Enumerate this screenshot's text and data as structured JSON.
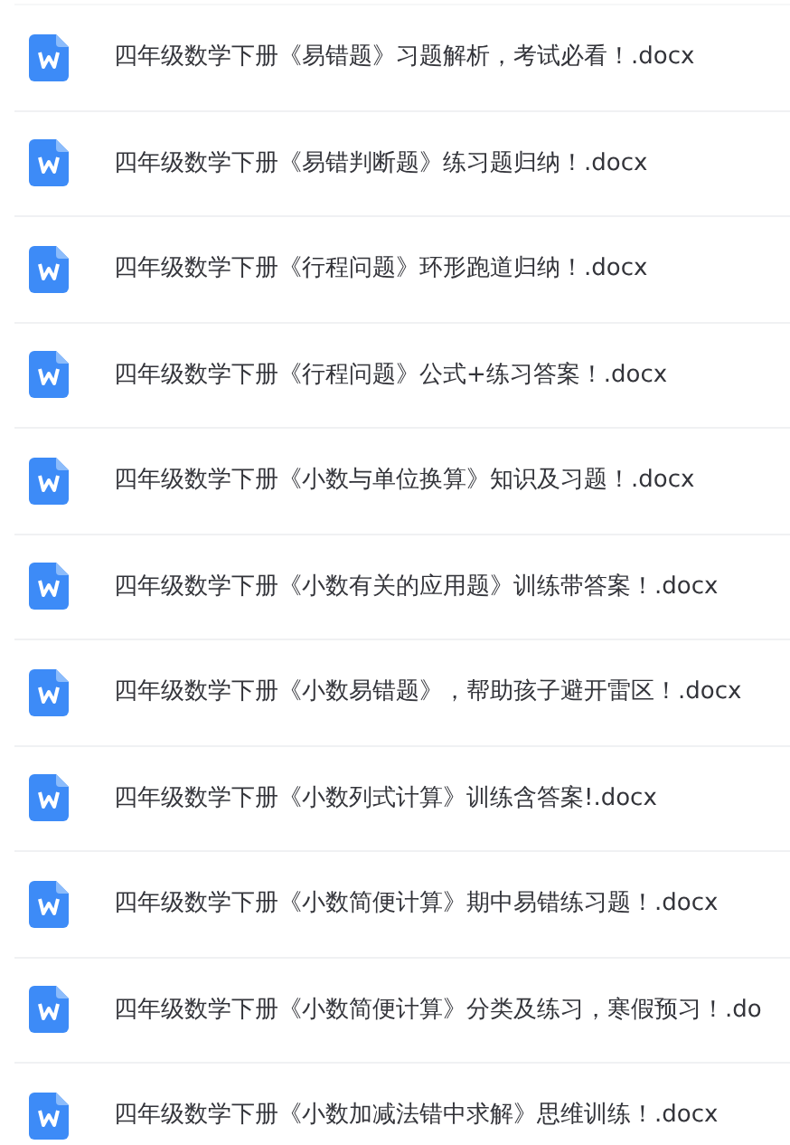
{
  "files": [
    {
      "name": "四年级数学下册《易错题》习题解析，考试必看！.docx"
    },
    {
      "name": "四年级数学下册《易错判断题》练习题归纳！.docx"
    },
    {
      "name": "四年级数学下册《行程问题》环形跑道归纳！.docx"
    },
    {
      "name": "四年级数学下册《行程问题》公式+练习答案！.docx"
    },
    {
      "name": "四年级数学下册《小数与单位换算》知识及习题！.docx"
    },
    {
      "name": "四年级数学下册《小数有关的应用题》训练带答案！.docx"
    },
    {
      "name": "四年级数学下册《小数易错题》，帮助孩子避开雷区！.docx"
    },
    {
      "name": "四年级数学下册《小数列式计算》训练含答案!.docx"
    },
    {
      "name": "四年级数学下册《小数简便计算》期中易错练习题！.docx"
    },
    {
      "name": "四年级数学下册《小数简便计算》分类及练习，寒假预习！.do"
    },
    {
      "name": "四年级数学下册《小数加减法错中求解》思维训练！.docx"
    }
  ]
}
